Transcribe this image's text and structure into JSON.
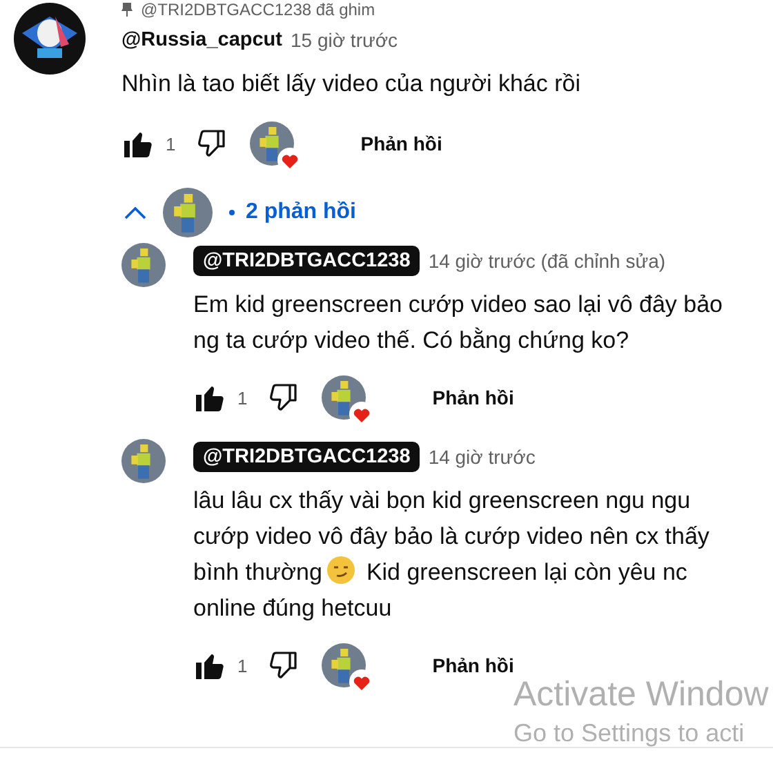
{
  "pinned_by": "@TRI2DBTGACC1238 đã ghim",
  "comment": {
    "author": "@Russia_capcut",
    "is_creator": false,
    "time": "15 giờ trước",
    "text": [
      {
        "kind": "text",
        "value": "Nhìn là tao biết lấy video của người khác rồi"
      }
    ],
    "likes": "1",
    "liked": true,
    "hearted": true,
    "reply_label": "Phản hồi"
  },
  "replies_toggle": {
    "expanded": true,
    "label": "2 phản hồi"
  },
  "replies": [
    {
      "author": "@TRI2DBTGACC1238",
      "is_creator": true,
      "time": "14 giờ trước (đã chỉnh sửa)",
      "text": [
        {
          "kind": "text",
          "value": "Em kid greenscreen cướp video sao lại vô đây bảo ng ta cướp video thế. Có bằng chứng ko?"
        }
      ],
      "likes": "1",
      "liked": true,
      "hearted": true,
      "reply_label": "Phản hồi"
    },
    {
      "author": "@TRI2DBTGACC1238",
      "is_creator": true,
      "time": "14 giờ trước",
      "text": [
        {
          "kind": "text",
          "value": "lâu lâu cx thấy vài bọn kid greenscreen ngu ngu cướp video vô đây bảo là cướp video nên cx thấy bình thường"
        },
        {
          "kind": "emoji"
        },
        {
          "kind": "text",
          "value": "Kid greenscreen lại còn yêu nc online đúng hetcuu"
        }
      ],
      "likes": "1",
      "liked": true,
      "hearted": true,
      "reply_label": "Phản hồi"
    }
  ],
  "system_notice": [
    "Activate Window",
    "Go to Settings to acti"
  ]
}
